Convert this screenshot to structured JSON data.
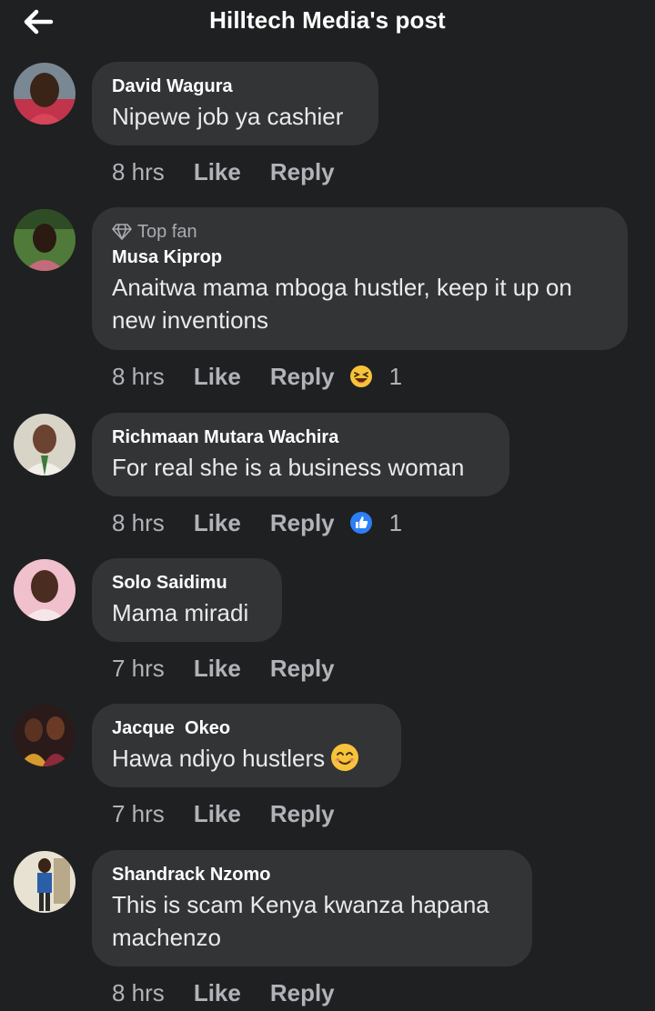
{
  "header": {
    "title": "Hilltech Media's post"
  },
  "colors": {
    "background": "#1f2022",
    "bubble": "#333436",
    "muted": "#b0b3b8",
    "like_blue": "#2d7ff5"
  },
  "comments": [
    {
      "author": "David Wagura",
      "text": "Nipewe job ya cashier",
      "time": "8 hrs",
      "like": "Like",
      "reply": "Reply"
    },
    {
      "badge": "Top fan",
      "author": "Musa Kiprop",
      "text": "Anaitwa mama mboga hustler, keep it up on new inventions",
      "time": "8 hrs",
      "like": "Like",
      "reply": "Reply",
      "reaction": "haha-icon",
      "reaction_count": "1"
    },
    {
      "author": "Richmaan Mutara Wachira",
      "text": "For real she is a business woman",
      "time": "8 hrs",
      "like": "Like",
      "reply": "Reply",
      "reaction": "like-reaction-icon",
      "reaction_count": "1"
    },
    {
      "author": "Solo Saidimu",
      "text": "Mama miradi",
      "time": "7 hrs",
      "like": "Like",
      "reply": "Reply"
    },
    {
      "author": "Jacque  Okeo",
      "text": "Hawa ndiyo hustlers",
      "text_emoji": "smiling-face-emoji",
      "time": "7 hrs",
      "like": "Like",
      "reply": "Reply"
    },
    {
      "author": "Shandrack Nzomo",
      "text": "This is scam Kenya kwanza hapana machenzo",
      "time": "8 hrs",
      "like": "Like",
      "reply": "Reply"
    }
  ]
}
